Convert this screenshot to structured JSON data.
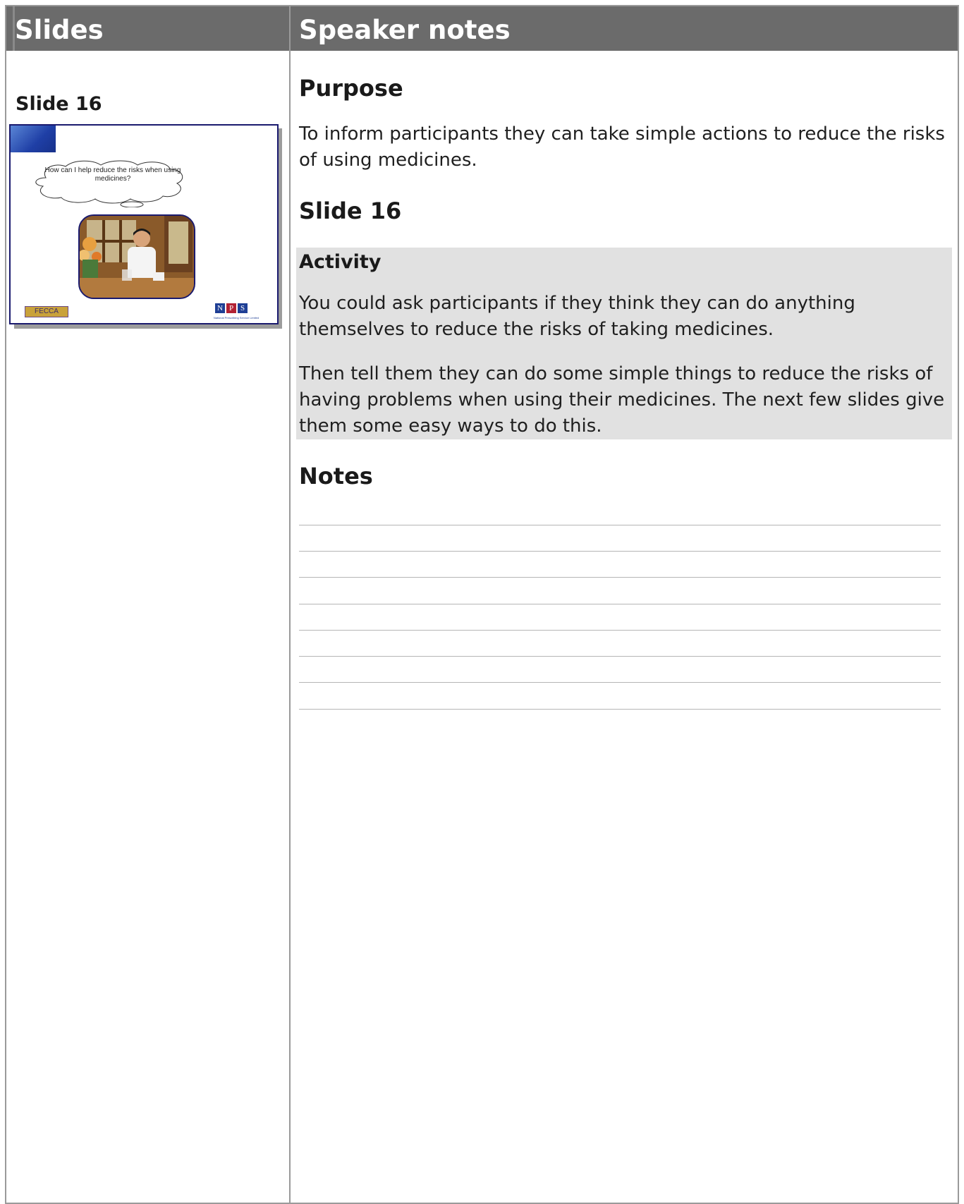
{
  "header": {
    "slides_label": "Slides",
    "notes_label": "Speaker notes"
  },
  "slide": {
    "label": "Slide 16",
    "thumbnail": {
      "thought_text": "How can I help reduce the risks when using medicines?",
      "logo_left": "FECCA",
      "logo_right_letters": [
        "N",
        "P",
        "S"
      ],
      "logo_right_sub": "National Prescribing Service Limited"
    }
  },
  "notes": {
    "purpose_heading": "Purpose",
    "purpose_text": "To inform participants they can take simple actions to reduce the risks of using medicines.",
    "slide_heading": "Slide 16",
    "activity": {
      "heading": "Activity",
      "para1": "You could ask participants if they think they can do anything themselves to reduce the risks of taking medicines.",
      "para2": "Then tell them they can do some simple things to reduce the risks of having problems when using their medicines. The next few slides give them some easy ways to do this."
    },
    "notes_heading": "Notes",
    "blank_lines": 8
  },
  "colors": {
    "header_bg": "#6b6b6b",
    "activity_bg": "#e1e1e1",
    "slide_border": "#1a1a6e"
  }
}
